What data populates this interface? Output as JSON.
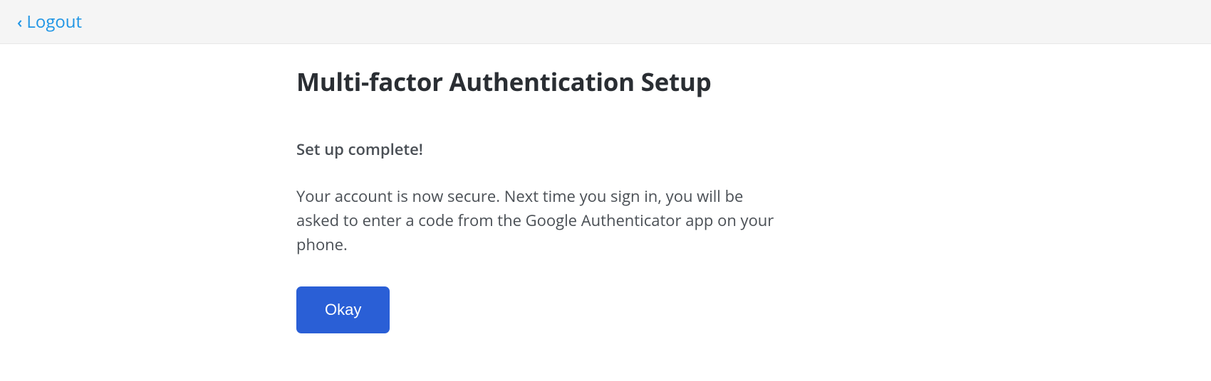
{
  "header": {
    "logout_label": "Logout"
  },
  "main": {
    "title": "Multi-factor Authentication Setup",
    "subtitle": "Set up complete!",
    "body": "Your account is now secure. Next time you sign in, you will be asked to enter a code from the Google Authenticator app on your phone.",
    "okay_label": "Okay"
  },
  "colors": {
    "link": "#2196e5",
    "button_bg": "#2a5fd6",
    "header_bg": "#f5f5f5"
  }
}
